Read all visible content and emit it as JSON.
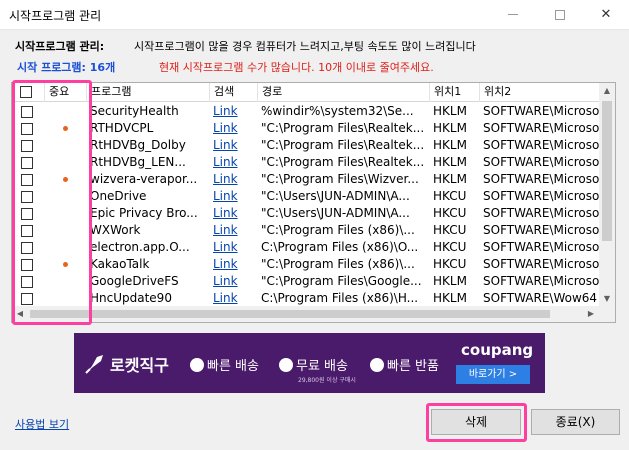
{
  "window": {
    "title": "시작프로그램 관리",
    "minimize": "—",
    "close": "✕"
  },
  "labels": {
    "manage": "시작프로그램 관리:",
    "description": "시작프로그램이 많을 경우 컴퓨터가 느려지고,부팅 속도도 많이 느려집니다",
    "count": "시작 프로그램: 16개",
    "warning": "현재 시작프로그램 수가 많습니다. 10개 이내로 줄여주세요."
  },
  "table": {
    "headers": [
      "",
      "중요",
      "프로그램",
      "검색",
      "경로",
      "위치1",
      "위치2"
    ],
    "rows": [
      {
        "important": false,
        "program": "SecurityHealth",
        "search": "Link",
        "path": "%windir%\\system32\\Se...",
        "loc1": "HKLM",
        "loc2": "SOFTWARE\\Microso"
      },
      {
        "important": true,
        "program": "RTHDVCPL",
        "search": "Link",
        "path": "\"C:\\Program Files\\Realtek...",
        "loc1": "HKLM",
        "loc2": "SOFTWARE\\Microso"
      },
      {
        "important": false,
        "program": "RtHDVBg_Dolby",
        "search": "Link",
        "path": "\"C:\\Program Files\\Realtek...",
        "loc1": "HKLM",
        "loc2": "SOFTWARE\\Microso"
      },
      {
        "important": false,
        "program": "RtHDVBg_LEN...",
        "search": "Link",
        "path": "\"C:\\Program Files\\Realtek...",
        "loc1": "HKLM",
        "loc2": "SOFTWARE\\Microso"
      },
      {
        "important": true,
        "program": "wizvera-verapor...",
        "search": "Link",
        "path": "\"C:\\Program Files\\Wizver...",
        "loc1": "HKLM",
        "loc2": "SOFTWARE\\Microso"
      },
      {
        "important": false,
        "program": "OneDrive",
        "search": "Link",
        "path": "\"C:\\Users\\JUN-ADMIN\\A...",
        "loc1": "HKCU",
        "loc2": "SOFTWARE\\Microso"
      },
      {
        "important": false,
        "program": "Epic Privacy Bro...",
        "search": "Link",
        "path": "\"C:\\Users\\JUN-ADMIN\\A...",
        "loc1": "HKCU",
        "loc2": "SOFTWARE\\Microso"
      },
      {
        "important": false,
        "program": "WXWork",
        "search": "Link",
        "path": "\"C:\\Program Files (x86)\\...",
        "loc1": "HKCU",
        "loc2": "SOFTWARE\\Microso"
      },
      {
        "important": false,
        "program": "electron.app.O...",
        "search": "Link",
        "path": "C:\\Program Files (x86)\\O...",
        "loc1": "HKCU",
        "loc2": "SOFTWARE\\Microso"
      },
      {
        "important": true,
        "program": "KakaoTalk",
        "search": "Link",
        "path": "\"C:\\Program Files (x86)\\...",
        "loc1": "HKCU",
        "loc2": "SOFTWARE\\Microso"
      },
      {
        "important": false,
        "program": "GoogleDriveFS",
        "search": "Link",
        "path": "\"C:\\Program Files\\Google...",
        "loc1": "HKLM",
        "loc2": "SOFTWARE\\Microso"
      },
      {
        "important": false,
        "program": "HncUpdate90",
        "search": "Link",
        "path": "C:\\Program Files (x86)\\H...",
        "loc1": "HKLM",
        "loc2": "SOFTWARE\\Wow64"
      }
    ]
  },
  "banner": {
    "main": "로켓직구",
    "feature1": "빠른 배송",
    "feature2": "무료 배송",
    "feature3": "빠른 반품",
    "subtext": "29,800원 이상 구매시",
    "brand": "coupang",
    "cta": "바로가기 >"
  },
  "footer": {
    "usage_link": "사용법 보기",
    "delete_button": "삭제",
    "close_button": "종료(X)"
  },
  "colors": {
    "highlight": "#ff3fa0",
    "important_dot": "#e8641e",
    "count_text": "#1a4fd6",
    "warning_text": "#e0201a",
    "banner_bg": "#4a1a6b"
  }
}
